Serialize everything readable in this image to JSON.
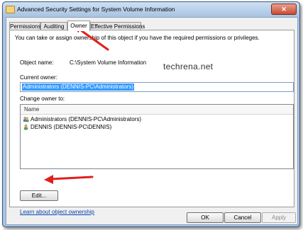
{
  "window": {
    "title": "Advanced Security Settings for System Volume Information",
    "close": "✕"
  },
  "tabs": [
    "Permissions",
    "Auditing",
    "Owner",
    "Effective Permissions"
  ],
  "owner_tab": {
    "intro": "You can take or assign ownership of this object if you have the required permissions or privileges.",
    "object_name_label": "Object name:",
    "object_name_value": "C:\\System Volume Information",
    "current_owner_label": "Current owner:",
    "current_owner_value": "Administrators (DENNIS-PC\\Administrators)",
    "change_owner_label": "Change owner to:",
    "list_header": "Name",
    "list_items": [
      {
        "name": "Administrators (DENNIS-PC\\Administrators)",
        "icon": "group-icon"
      },
      {
        "name": "DENNIS (DENNIS-PC\\DENNIS)",
        "icon": "user-icon"
      }
    ],
    "edit_button": "Edit...",
    "learn_link": "Learn about object ownership"
  },
  "watermark": "techrena.net",
  "footer": {
    "ok": "OK",
    "cancel": "Cancel",
    "apply": "Apply"
  },
  "colors": {
    "arrow": "#e0201b",
    "selection": "#3399ff",
    "titlebar": "#b9d1ea"
  }
}
